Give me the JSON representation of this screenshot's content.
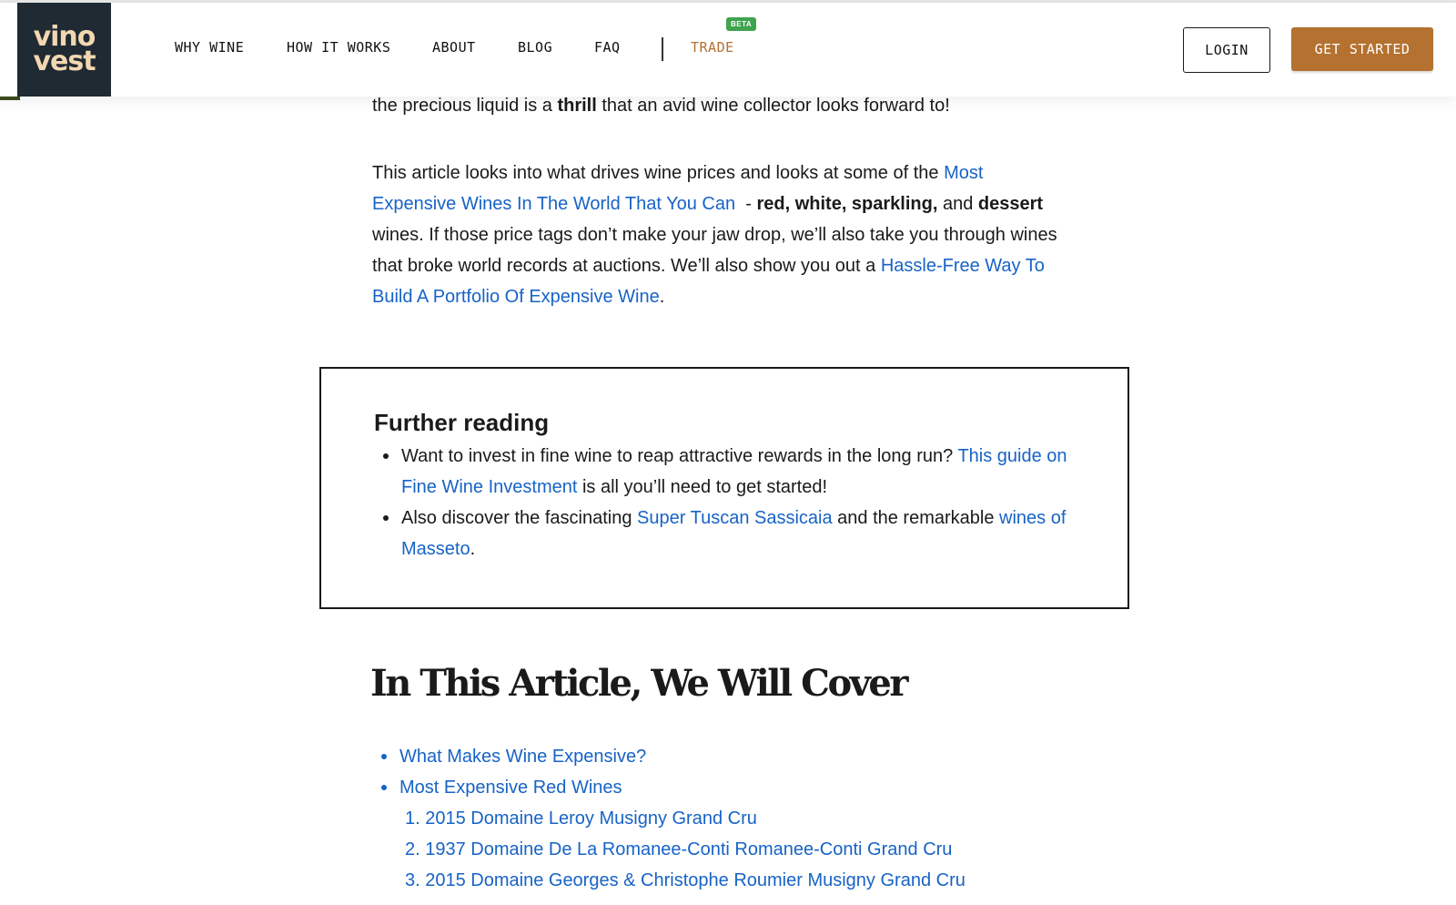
{
  "header": {
    "logo_line1": "vino",
    "logo_line2": "vest",
    "nav": [
      "WHY WINE",
      "HOW IT WORKS",
      "ABOUT",
      "BLOG",
      "FAQ",
      "TRADE"
    ],
    "beta_badge": "BETA",
    "login_label": "LOGIN",
    "get_started_label": "GET STARTED"
  },
  "intro": {
    "p1_a": "the precious liquid is a ",
    "p1_bold": "thrill",
    "p1_b": " that an avid wine collector looks forward to!",
    "p2_a": "This article looks into what drives wine prices and looks at some of the ",
    "p2_link1": "Most Expensive Wines In The World That You Can",
    "p2_b": "  - ",
    "p2_bold1": "red, white, sparkling,",
    "p2_c": " and ",
    "p2_bold2": "dessert",
    "p2_d": " wines. If those price tags don’t make your jaw drop, we’ll also take you through wines that broke world records at auctions.  We’ll also show you out a ",
    "p2_link2": "Hassle-Free Way To Build A Portfolio Of Expensive Wine",
    "p2_e": "."
  },
  "further_reading": {
    "title": "Further reading",
    "item1_a": "Want to invest in fine wine to reap attractive rewards in the long run? ",
    "item1_link": "This guide on Fine Wine Investment",
    "item1_b": " is all you’ll need to get started!",
    "item2_a": "Also discover the fascinating ",
    "item2_link1": "Super Tuscan Sassicaia",
    "item2_b": " and the remarkable ",
    "item2_link2": "wines of Masseto",
    "item2_c": "."
  },
  "toc": {
    "heading": "In This Article, We Will Cover",
    "bullets": [
      "What Makes Wine Expensive?",
      "Most Expensive Red Wines"
    ],
    "numbered": [
      "1. 2015 Domaine Leroy Musigny Grand Cru",
      "2. 1937 Domaine De La Romanee-Conti Romanee-Conti Grand Cru",
      "3. 2015 Domaine Georges & Christophe Roumier Musigny Grand Cru"
    ]
  },
  "colors": {
    "accent": "#b4712f",
    "link": "#1763c6",
    "logo_bg": "#1f2a33",
    "beta": "#3fa34d"
  }
}
